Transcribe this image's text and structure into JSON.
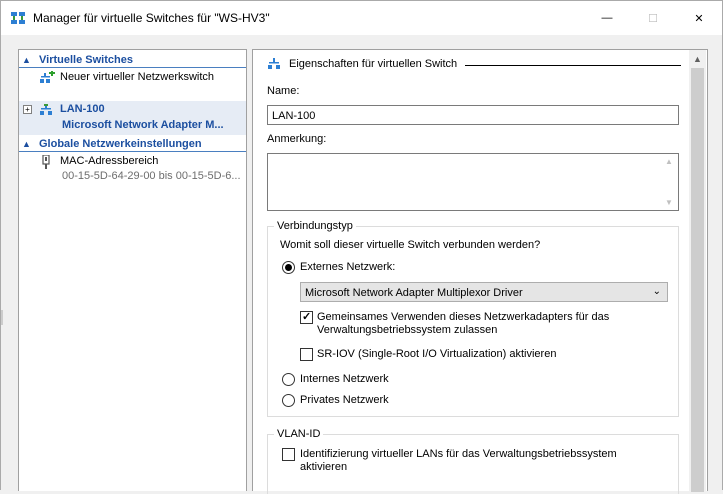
{
  "window": {
    "title": "Manager für virtuelle Switches für \"WS-HV3\"",
    "minimize_glyph": "—",
    "maximize_glyph": "☐",
    "close_glyph": "✕"
  },
  "left": {
    "virtual_switches_header": "Virtuelle Switches",
    "new_switch_label": "Neuer virtueller Netzwerkswitch",
    "lan_name": "LAN-100",
    "lan_adapter": "Microsoft Network Adapter M...",
    "global_header": "Globale Netzwerkeinstellungen",
    "mac_label": "MAC-Adressbereich",
    "mac_range": "00-15-5D-64-29-00 bis 00-15-5D-6..."
  },
  "right": {
    "props_title": "Eigenschaften für virtuellen Switch",
    "name_label": "Name:",
    "name_value": "LAN-100",
    "note_label": "Anmerkung:",
    "note_value": "",
    "conn_group": "Verbindungstyp",
    "conn_question": "Womit soll dieser virtuelle Switch verbunden werden?",
    "external_label": "Externes Netzwerk:",
    "adapter_value": "Microsoft Network Adapter Multiplexor Driver",
    "share_line1": "Gemeinsames Verwenden dieses Netzwerkadapters für das",
    "share_line2": "Verwaltungsbetriebssystem zulassen",
    "sriov_label": "SR-IOV (Single-Root I/O Virtualization) aktivieren",
    "internal_label": "Internes Netzwerk",
    "private_label": "Privates Netzwerk",
    "vlan_group": "VLAN-ID",
    "vlan_line1": "Identifizierung virtueller LANs für das Verwaltungsbetriebssystem",
    "vlan_line2": "aktivieren"
  },
  "state": {
    "connection_type": "external",
    "share_checked": true,
    "sriov_checked": false,
    "vlan_checked": false
  },
  "icons": [
    "switch-manager-icon",
    "new-switch-icon",
    "network-switch-icon",
    "mac-address-icon",
    "collapse-chevron-icon",
    "expand-plus-icon",
    "dropdown-arrow-icon",
    "scroll-up-icon"
  ],
  "colors": {
    "accent": "#1c4fa0",
    "selection": "#e6ecf5",
    "muted": "#6d6d6d"
  }
}
